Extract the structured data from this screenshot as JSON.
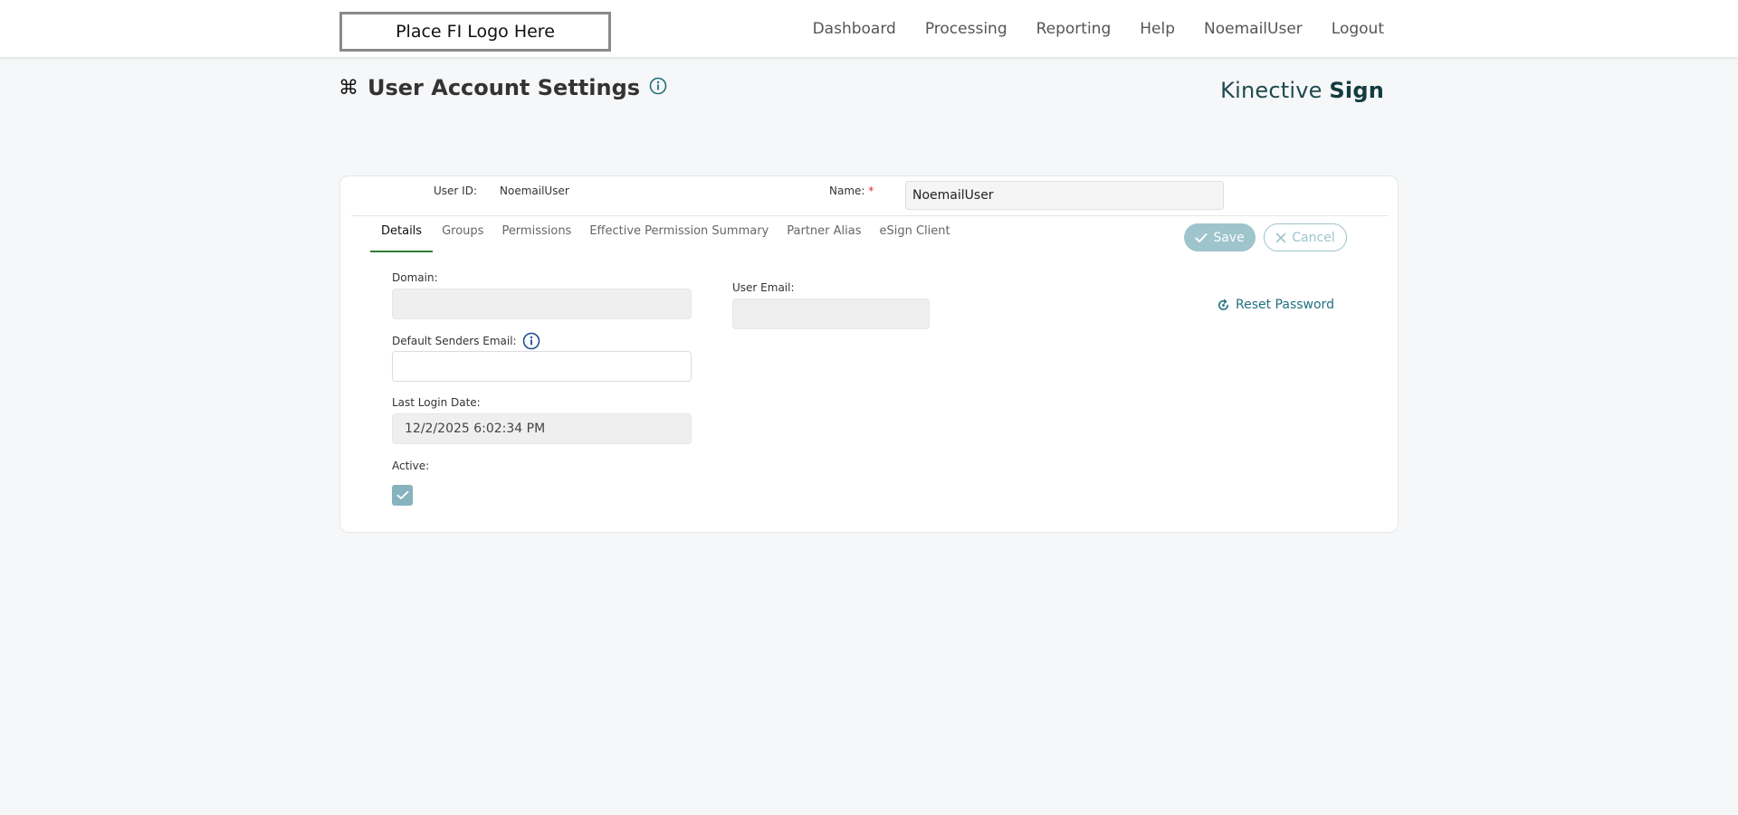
{
  "header": {
    "logo_text": "Place FI Logo Here",
    "nav": [
      "Dashboard",
      "Processing",
      "Reporting",
      "Help",
      "NoemailUser",
      "Logout"
    ]
  },
  "page": {
    "title": "User Account Settings",
    "brand_light": "Kinective",
    "brand_bold": "Sign"
  },
  "form_head": {
    "user_id_label": "User ID:",
    "user_id_value": "NoemailUser",
    "name_label": "Name:",
    "name_required": "*",
    "name_value": "NoemailUser"
  },
  "tabs": [
    "Details",
    "Groups",
    "Permissions",
    "Effective Permission Summary",
    "Partner Alias",
    "eSign Client"
  ],
  "active_tab": "Details",
  "actions": {
    "save_label": "Save",
    "cancel_label": "Cancel",
    "reset_password_label": "Reset Password"
  },
  "details": {
    "domain_label": "Domain:",
    "domain_value": "",
    "user_email_label": "User Email:",
    "user_email_value": "",
    "default_senders_email_label": "Default Senders Email:",
    "default_senders_email_value": "",
    "last_login_label": "Last Login Date:",
    "last_login_value": "12/2/2025 6:02:34 PM",
    "active_label": "Active:",
    "active_checked": true
  },
  "colors": {
    "accent": "#20707e",
    "tab_underline": "#2e7d32",
    "button_disabled": "#9ec4cc"
  }
}
